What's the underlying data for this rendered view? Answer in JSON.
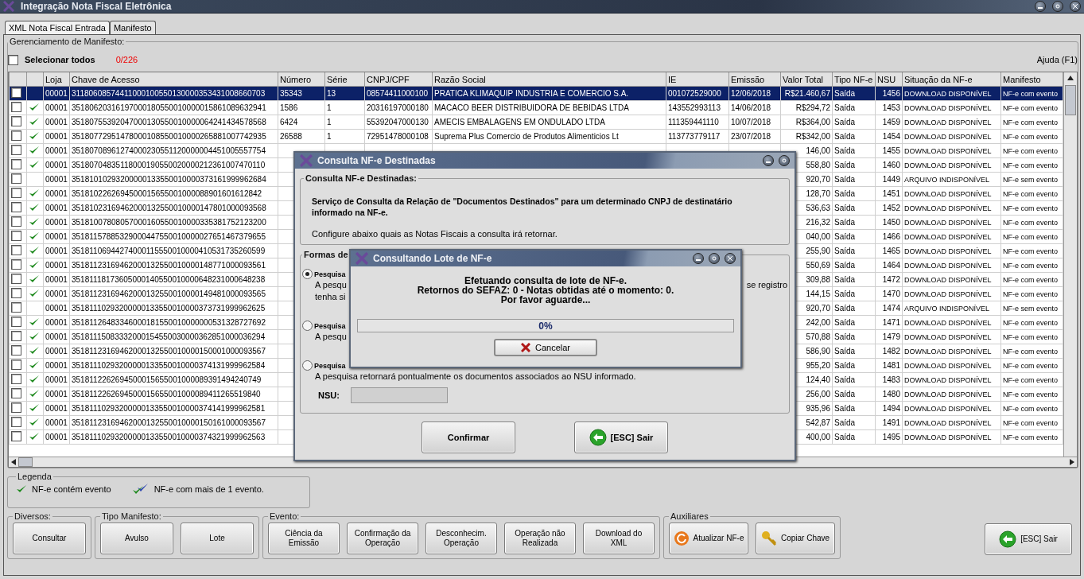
{
  "window": {
    "title": "Integração Nota Fiscal Eletrônica"
  },
  "tabs": [
    {
      "label": "XML Nota Fiscal Entrada",
      "selected": false
    },
    {
      "label": "Manifesto",
      "selected": true
    }
  ],
  "manifest_panel": {
    "title": "Gerenciamento de Manifesto:",
    "select_all": {
      "label": "Selecionar todos",
      "checked": false
    },
    "count": "0/226",
    "help": "Ajuda (F1)"
  },
  "table": {
    "columns": [
      "Loja",
      "Chave de Acesso",
      "Número",
      "Série",
      "CNPJ/CPF",
      "Razão Social",
      "IE",
      "Emissão",
      "Valor Total",
      "Tipo NF-e",
      "NSU",
      "Situação da NF-e",
      "Manifesto"
    ],
    "rows": [
      {
        "selected": true,
        "checked": false,
        "has_event": false,
        "cells": [
          "00001",
          "31180608574411000100550130000353431008660703",
          "35343",
          "13",
          "08574411000100",
          "PRATICA KLIMAQUIP INDUSTRIA E COMERCIO S.A.",
          "001072529000",
          "12/06/2018",
          "R$21.460,67",
          "Saída",
          "1456",
          "DOWNLOAD DISPONÍVEL",
          "NF-e com evento"
        ]
      },
      {
        "selected": false,
        "checked": false,
        "has_event": true,
        "cells": [
          "00001",
          "35180620316197000180550010000015861089632941",
          "1586",
          "1",
          "20316197000180",
          "MACACO BEER DISTRIBUIDORA DE BEBIDAS LTDA",
          "143552993113",
          "14/06/2018",
          "R$294,72",
          "Saída",
          "1453",
          "DOWNLOAD DISPONÍVEL",
          "NF-e com evento"
        ]
      },
      {
        "selected": false,
        "checked": false,
        "has_event": true,
        "cells": [
          "00001",
          "35180755392047000130550010000064241434578568",
          "6424",
          "1",
          "55392047000130",
          "AMECIS EMBALAGENS EM ONDULADO LTDA",
          "111359441110",
          "10/07/2018",
          "R$364,00",
          "Saída",
          "1459",
          "DOWNLOAD DISPONÍVEL",
          "NF-e com evento"
        ]
      },
      {
        "selected": false,
        "checked": false,
        "has_event": true,
        "cells": [
          "00001",
          "35180772951478000108550010000265881007742935",
          "26588",
          "1",
          "72951478000108",
          "Suprema Plus Comercio de Produtos Alimenticios Lt",
          "113773779117",
          "23/07/2018",
          "R$342,00",
          "Saída",
          "1454",
          "DOWNLOAD DISPONÍVEL",
          "NF-e com evento"
        ]
      },
      {
        "selected": false,
        "checked": false,
        "has_event": true,
        "cells": [
          "00001",
          "35180708961274000230551120000004451005557754",
          null,
          null,
          null,
          null,
          null,
          null,
          "146,00",
          "Saída",
          "1455",
          "DOWNLOAD DISPONÍVEL",
          "NF-e com evento"
        ]
      },
      {
        "selected": false,
        "checked": false,
        "has_event": true,
        "cells": [
          "00001",
          "35180704835118000190550020000212361007470110",
          null,
          null,
          null,
          null,
          null,
          null,
          "558,80",
          "Saída",
          "1460",
          "DOWNLOAD DISPONÍVEL",
          "NF-e com evento"
        ]
      },
      {
        "selected": false,
        "checked": false,
        "has_event": false,
        "cells": [
          "00001",
          "35181010293200000133550010000373161999962684",
          null,
          null,
          null,
          null,
          null,
          null,
          "920,70",
          "Saída",
          "1449",
          "ARQUIVO INDISPONÍVEL",
          "NF-e sem evento"
        ]
      },
      {
        "selected": false,
        "checked": false,
        "has_event": true,
        "cells": [
          "00001",
          "3518102262694500015655001000088901601612842",
          null,
          null,
          null,
          null,
          null,
          null,
          "128,70",
          "Saída",
          "1451",
          "DOWNLOAD DISPONÍVEL",
          "NF-e com evento"
        ]
      },
      {
        "selected": false,
        "checked": false,
        "has_event": true,
        "cells": [
          "00001",
          "35181023169462000132550010000147801000093568",
          null,
          null,
          null,
          null,
          null,
          null,
          "536,63",
          "Saída",
          "1452",
          "DOWNLOAD DISPONÍVEL",
          "NF-e com evento"
        ]
      },
      {
        "selected": false,
        "checked": false,
        "has_event": true,
        "cells": [
          "00001",
          "35181007808057000160550010000335381752123200",
          null,
          null,
          null,
          null,
          null,
          null,
          "216,32",
          "Saída",
          "1450",
          "DOWNLOAD DISPONÍVEL",
          "NF-e com evento"
        ]
      },
      {
        "selected": false,
        "checked": false,
        "has_event": true,
        "cells": [
          "00001",
          "35181157885329000447550010000027651467379655",
          null,
          null,
          null,
          null,
          null,
          null,
          "040,00",
          "Saída",
          "1466",
          "DOWNLOAD DISPONÍVEL",
          "NF-e com evento"
        ]
      },
      {
        "selected": false,
        "checked": false,
        "has_event": true,
        "cells": [
          "00001",
          "35181106944274000115550010000410531735260599",
          null,
          null,
          null,
          null,
          null,
          null,
          "255,90",
          "Saída",
          "1465",
          "DOWNLOAD DISPONÍVEL",
          "NF-e com evento"
        ]
      },
      {
        "selected": false,
        "checked": false,
        "has_event": true,
        "cells": [
          "00001",
          "35181123169462000132550010000148771000093561",
          null,
          null,
          null,
          null,
          null,
          null,
          "550,69",
          "Saída",
          "1464",
          "DOWNLOAD DISPONÍVEL",
          "NF-e com evento"
        ]
      },
      {
        "selected": false,
        "checked": false,
        "has_event": true,
        "cells": [
          "00001",
          "35181118173605000140550010000648231000648238",
          null,
          null,
          null,
          null,
          null,
          null,
          "309,88",
          "Saída",
          "1472",
          "DOWNLOAD DISPONÍVEL",
          "NF-e com evento"
        ]
      },
      {
        "selected": false,
        "checked": false,
        "has_event": true,
        "cells": [
          "00001",
          "35181123169462000132550010000149481000093565",
          null,
          null,
          null,
          null,
          null,
          null,
          "144,15",
          "Saída",
          "1470",
          "DOWNLOAD DISPONÍVEL",
          "NF-e com evento"
        ]
      },
      {
        "selected": false,
        "checked": false,
        "has_event": false,
        "cells": [
          "00001",
          "35181110293200000133550010000373731999962625",
          null,
          null,
          null,
          null,
          null,
          null,
          "920,70",
          "Saída",
          "1474",
          "ARQUIVO INDISPONÍVEL",
          "NF-e sem evento"
        ]
      },
      {
        "selected": false,
        "checked": false,
        "has_event": true,
        "cells": [
          "00001",
          "35181126483346000181550010000000531328727692",
          null,
          null,
          null,
          null,
          null,
          null,
          "242,00",
          "Saída",
          "1471",
          "DOWNLOAD DISPONÍVEL",
          "NF-e com evento"
        ]
      },
      {
        "selected": false,
        "checked": false,
        "has_event": true,
        "cells": [
          "00001",
          "35181115083332000154550030000362851000036294",
          null,
          null,
          null,
          null,
          null,
          null,
          "570,88",
          "Saída",
          "1479",
          "DOWNLOAD DISPONÍVEL",
          "NF-e com evento"
        ]
      },
      {
        "selected": false,
        "checked": false,
        "has_event": true,
        "cells": [
          "00001",
          "35181123169462000132550010000150001000093567",
          null,
          null,
          null,
          null,
          null,
          null,
          "586,90",
          "Saída",
          "1482",
          "DOWNLOAD DISPONÍVEL",
          "NF-e com evento"
        ]
      },
      {
        "selected": false,
        "checked": false,
        "has_event": true,
        "cells": [
          "00001",
          "35181110293200000133550010000374131999962584",
          null,
          null,
          null,
          null,
          null,
          null,
          "955,20",
          "Saída",
          "1481",
          "DOWNLOAD DISPONÍVEL",
          "NF-e com evento"
        ]
      },
      {
        "selected": false,
        "checked": false,
        "has_event": true,
        "cells": [
          "00001",
          "3518112262694500015655001000089391494240749",
          null,
          null,
          null,
          null,
          null,
          null,
          "124,40",
          "Saída",
          "1483",
          "DOWNLOAD DISPONÍVEL",
          "NF-e com evento"
        ]
      },
      {
        "selected": false,
        "checked": false,
        "has_event": true,
        "cells": [
          "00001",
          "3518112262694500015655001000089411265519840",
          null,
          null,
          null,
          null,
          null,
          null,
          "256,00",
          "Saída",
          "1480",
          "DOWNLOAD DISPONÍVEL",
          "NF-e com evento"
        ]
      },
      {
        "selected": false,
        "checked": false,
        "has_event": true,
        "cells": [
          "00001",
          "35181110293200000133550010000374141999962581",
          null,
          null,
          null,
          null,
          null,
          null,
          "935,96",
          "Saída",
          "1494",
          "DOWNLOAD DISPONÍVEL",
          "NF-e com evento"
        ]
      },
      {
        "selected": false,
        "checked": false,
        "has_event": true,
        "cells": [
          "00001",
          "35181123169462000132550010000150161000093567",
          null,
          null,
          null,
          null,
          null,
          null,
          "542,87",
          "Saída",
          "1491",
          "DOWNLOAD DISPONÍVEL",
          "NF-e com evento"
        ]
      },
      {
        "selected": false,
        "checked": false,
        "has_event": true,
        "cells": [
          "00001",
          "35181110293200000133550010000374321999962563",
          null,
          null,
          null,
          null,
          null,
          null,
          "400,00",
          "Saída",
          "1495",
          "DOWNLOAD DISPONÍVEL",
          "NF-e com evento"
        ]
      }
    ]
  },
  "legend": {
    "title": "Legenda",
    "items": [
      {
        "kind": "single",
        "label": "NF-e contém evento"
      },
      {
        "kind": "multiple",
        "label": "NF-e com mais de 1 evento."
      }
    ]
  },
  "button_groups": [
    {
      "title": "Diversos:",
      "buttons": [
        {
          "label": "Consultar",
          "kind": "plain"
        }
      ]
    },
    {
      "title": "Tipo Manifesto:",
      "buttons": [
        {
          "label": "Avulso",
          "kind": "plain"
        },
        {
          "label": "Lote",
          "kind": "plain"
        }
      ]
    },
    {
      "title": "Evento:",
      "buttons": [
        {
          "label": "Ciência da Emissão",
          "kind": "plain"
        },
        {
          "label": "Confirmação da Operação",
          "kind": "plain"
        },
        {
          "label": "Desconhecim. Operação",
          "kind": "plain"
        },
        {
          "label": "Operação não Realizada",
          "kind": "plain"
        },
        {
          "label": "Download do XML",
          "kind": "plain"
        }
      ]
    },
    {
      "title": "Auxiliares",
      "buttons": [
        {
          "label": "Atualizar NF-e",
          "kind": "refresh"
        },
        {
          "label": "Copiar Chave",
          "kind": "key"
        }
      ]
    }
  ],
  "exit_button": {
    "label": "[ESC] Sair",
    "kind": "back"
  },
  "query_dialog": {
    "title": "Consulta NF-e Destinadas",
    "group_title": "Consulta NF-e Destinadas:",
    "description": "Serviço de Consulta da Relação de \"Documentos Destinados\" para um determinado CNPJ de destinatário informado na NF-e.",
    "note": "Configure abaixo quais as Notas Fiscais a consulta irá retornar.",
    "options_title": "Formas de",
    "options": [
      {
        "label": "Pesquisa",
        "selected": true,
        "lines": [
          "A pesqu",
          "tenha si"
        ],
        "trailing": "se registro"
      },
      {
        "label": "Pesquisa",
        "selected": false,
        "lines": [
          "A pesqu"
        ]
      },
      {
        "label": "Pesquisa",
        "selected": false,
        "lines": [
          "A pesquisa retornará pontualmente os documentos associados ao NSU informado."
        ]
      }
    ],
    "nsu": {
      "label": "NSU:",
      "disabled": true
    },
    "buttons": [
      {
        "label": "Confirmar",
        "kind": "plain"
      },
      {
        "label": "[ESC] Sair",
        "kind": "back"
      }
    ]
  },
  "progress_dialog": {
    "title": "Consultando Lote de NF-e",
    "messages": [
      "Efetuando consulta de lote de NF-e.",
      "Retornos do SEFAZ: 0 - Notas obtidas até o momento: 0.",
      "Por favor aguarde..."
    ],
    "progress": {
      "level": 0,
      "reading": "0%"
    },
    "cancel": "Cancelar"
  }
}
